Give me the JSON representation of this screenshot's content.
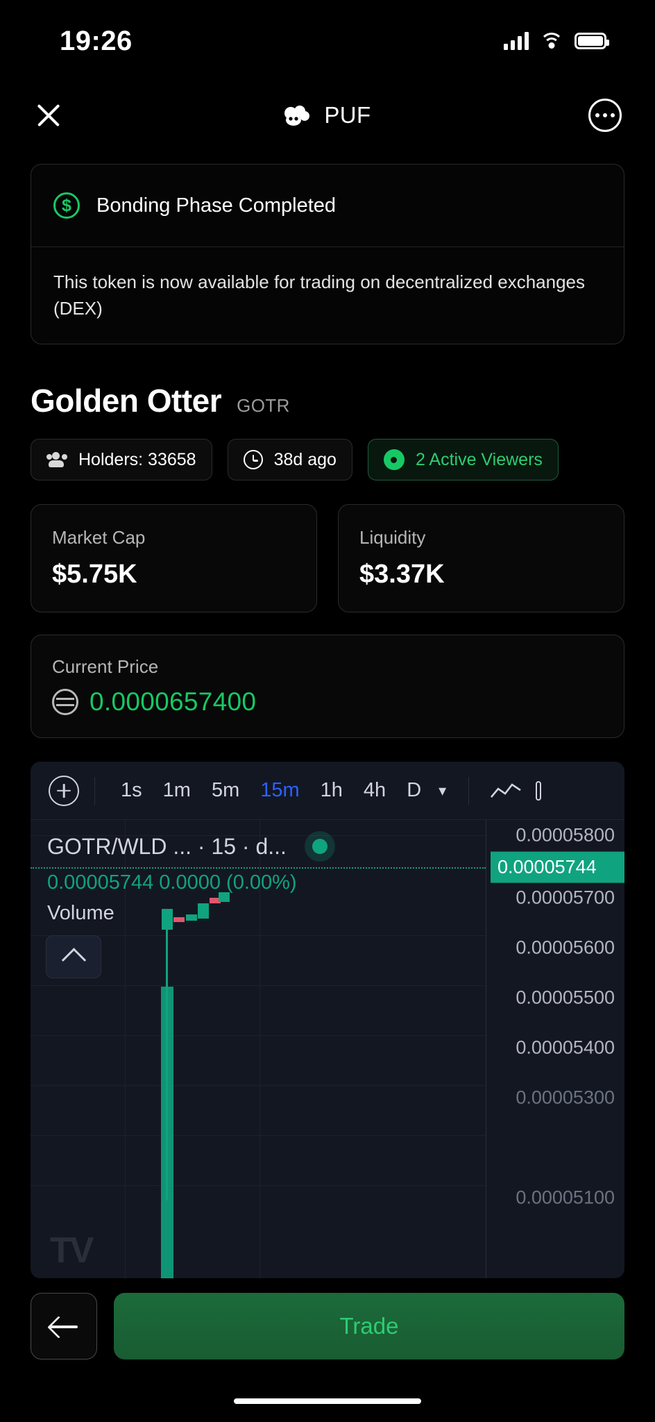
{
  "statusbar": {
    "time": "19:26",
    "icons": [
      "cellular-signal-icon",
      "wifi-icon",
      "battery-icon"
    ]
  },
  "header": {
    "close_label": "close-icon",
    "brand_icon": "puff-cloud-icon",
    "brand_name": "PUF",
    "more_label": "more-options-icon"
  },
  "notice": {
    "icon": "dollar-circle-icon",
    "title": "Bonding Phase Completed",
    "body": "This token is now available for trading on decentralized exchanges (DEX)"
  },
  "token": {
    "name": "Golden Otter",
    "ticker": "GOTR",
    "badges": [
      {
        "icon": "people-icon",
        "label": "Holders: 33658"
      },
      {
        "icon": "clock-icon",
        "label": "38d ago"
      },
      {
        "icon": "eye-icon",
        "label": "2 Active Viewers"
      }
    ]
  },
  "stats": [
    {
      "label": "Market Cap",
      "value": "$5.75K"
    },
    {
      "label": "Liquidity",
      "value": "$3.37K"
    }
  ],
  "current_price": {
    "label": "Current Price",
    "icon": "wld-coin-icon",
    "value": "0.0000657400",
    "color": "#17c964"
  },
  "chart_toolbar": {
    "add_label": "plus-circle-icon",
    "timeframes": [
      {
        "label": "1s",
        "active": false
      },
      {
        "label": "1m",
        "active": false
      },
      {
        "label": "5m",
        "active": false
      },
      {
        "label": "15m",
        "active": true
      },
      {
        "label": "1h",
        "active": false
      },
      {
        "label": "4h",
        "active": false
      },
      {
        "label": "D",
        "active": false
      }
    ],
    "chevron": "∨",
    "chart_type_icon": "line-chart-icon",
    "indicator_icon": "indicator-icon"
  },
  "chart_data": {
    "type": "line",
    "title": "GOTR/WLD ... · 15 · d...",
    "symbol": "GOTR/WLD",
    "interval": "15",
    "last_price": "0.00005744",
    "change_abs": "0.0000",
    "change_pct": "(0.00%)",
    "current_badge": "0.00005744",
    "volume_label": "Volume",
    "watermark": "TV",
    "legend_position": "top-left",
    "grid": true,
    "ylabel": "",
    "xlabel": "",
    "y_ticks": [
      "0.00005800",
      "0.00005700",
      "0.00005600",
      "0.00005500",
      "0.00005400",
      "0.00005300",
      "0.00005100"
    ],
    "ylim": [
      5.1e-05,
      5.8e-05
    ],
    "colors": {
      "up": "#10a37f",
      "down": "#e0576c",
      "background": "#131722"
    },
    "candles": [
      {
        "x": 195,
        "open": 5.3e-05,
        "close": 5.7e-05,
        "high": 5.71e-05,
        "low": 5.09e-05,
        "dir": "up"
      },
      {
        "x": 214,
        "open": 5.7e-05,
        "close": 5.69e-05,
        "high": 5.715e-05,
        "low": 5.68e-05,
        "dir": "down"
      },
      {
        "x": 232,
        "open": 5.69e-05,
        "close": 5.705e-05,
        "high": 5.715e-05,
        "low": 5.685e-05,
        "dir": "up"
      },
      {
        "x": 248,
        "open": 5.705e-05,
        "close": 5.73e-05,
        "high": 5.735e-05,
        "low": 5.7e-05,
        "dir": "up"
      },
      {
        "x": 264,
        "open": 5.73e-05,
        "close": 5.735e-05,
        "high": 5.745e-05,
        "low": 5.725e-05,
        "dir": "up"
      },
      {
        "x": 280,
        "open": 5.735e-05,
        "close": 5.744e-05,
        "high": 5.748e-05,
        "low": 5.732e-05,
        "dir": "up"
      }
    ],
    "volume": [
      {
        "x": 195,
        "value": 1.0
      },
      {
        "x": 214,
        "value": 0.12
      },
      {
        "x": 232,
        "value": 0.1
      },
      {
        "x": 248,
        "value": 0.08
      },
      {
        "x": 264,
        "value": 0.06
      },
      {
        "x": 280,
        "value": 0.05
      }
    ]
  },
  "bottom": {
    "back_label": "back-arrow-icon",
    "trade_label": "Trade"
  }
}
